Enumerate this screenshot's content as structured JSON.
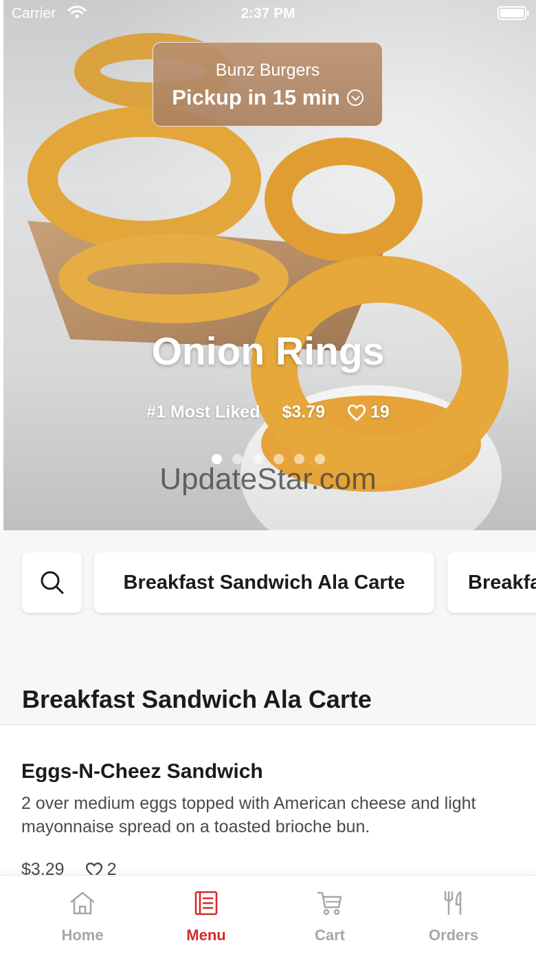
{
  "status_bar": {
    "carrier": "Carrier",
    "time": "2:37 PM"
  },
  "pickup": {
    "store": "Bunz Burgers",
    "line": "Pickup in 15 min"
  },
  "hero": {
    "title": "Onion Rings",
    "rank": "#1 Most Liked",
    "price": "$3.79",
    "likes": "19",
    "slides_total": 6,
    "active_slide": 1
  },
  "watermark": "UpdateStar.com",
  "categories": {
    "items": [
      "Breakfast Sandwich Ala Carte",
      "Breakfa"
    ]
  },
  "section": {
    "title": "Breakfast Sandwich Ala Carte"
  },
  "menu_item": {
    "name": "Eggs-N-Cheez Sandwich",
    "description": "2 over medium eggs topped with American cheese and light mayonnaise spread on a toasted brioche bun.",
    "price": "$3.29",
    "likes": "2"
  },
  "tabs": [
    {
      "label": "Home",
      "icon": "home-icon",
      "active": false
    },
    {
      "label": "Menu",
      "icon": "menu-icon",
      "active": true
    },
    {
      "label": "Cart",
      "icon": "cart-icon",
      "active": false
    },
    {
      "label": "Orders",
      "icon": "orders-icon",
      "active": false
    }
  ],
  "colors": {
    "accent": "#d42a2a",
    "inactive_tab": "#a6a6a6",
    "pickup_card": "#b48b66"
  }
}
